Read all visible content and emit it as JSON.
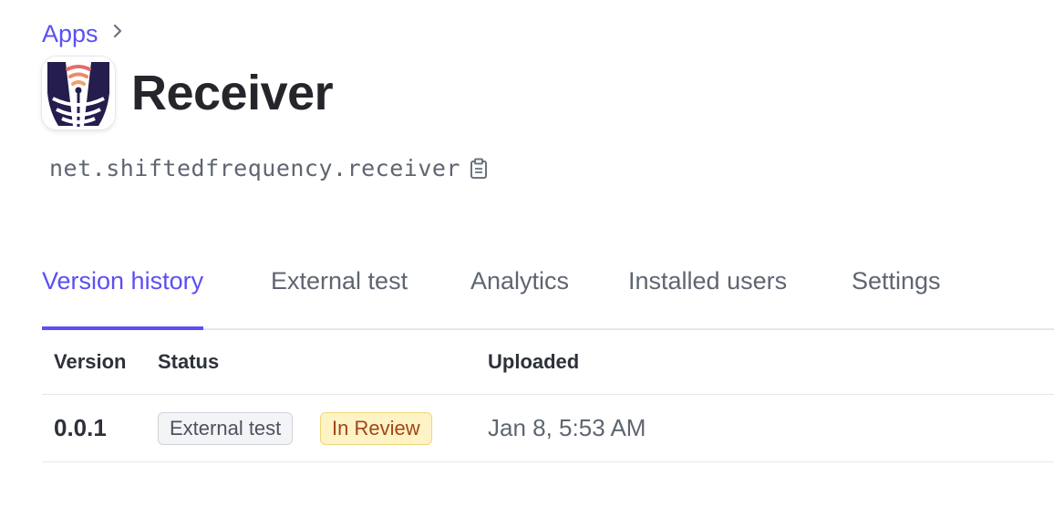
{
  "breadcrumb": {
    "apps_label": "Apps",
    "separator_icon": "chevron-right-icon"
  },
  "app": {
    "name": "Receiver",
    "bundle_id": "net.shiftedfrequency.receiver",
    "icon": "receiver-app-icon",
    "copy_icon": "clipboard-icon"
  },
  "tabs": [
    {
      "label": "Version history",
      "active": true
    },
    {
      "label": "External test",
      "active": false
    },
    {
      "label": "Analytics",
      "active": false
    },
    {
      "label": "Installed users",
      "active": false
    },
    {
      "label": "Settings",
      "active": false
    }
  ],
  "table": {
    "columns": [
      "Version",
      "Status",
      "Uploaded"
    ],
    "rows": [
      {
        "version": "0.0.1",
        "badges": [
          "External test",
          "In Review"
        ],
        "uploaded": "Jan 8, 5:53 AM"
      }
    ]
  },
  "colors": {
    "accent": "#5b4ff5",
    "review_badge_bg": "#fdf3c4",
    "review_badge_text": "#a2461a",
    "neutral_badge_bg": "#f3f4f6"
  }
}
